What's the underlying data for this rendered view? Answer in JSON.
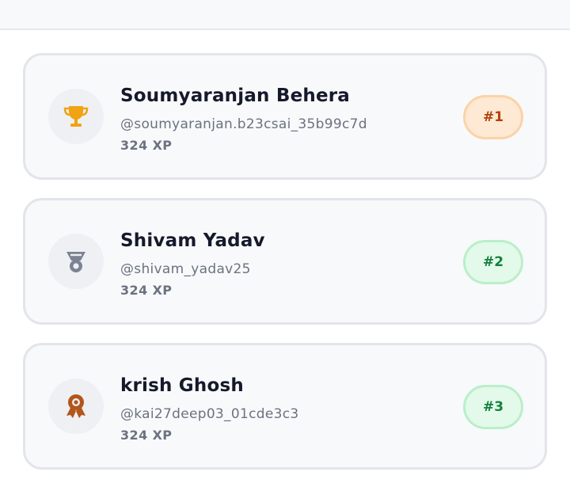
{
  "leaderboard": {
    "entries": [
      {
        "rank_label": "#1",
        "name": "Soumyaranjan Behera",
        "handle": "@soumyaranjan.b23csai_35b99c7d",
        "xp": "324 XP",
        "icon": "trophy-icon",
        "icon_color": "#f0a313",
        "badge_color": "#b4410f"
      },
      {
        "rank_label": "#2",
        "name": "Shivam Yadav",
        "handle": "@shivam_yadav25",
        "xp": "324 XP",
        "icon": "medal-icon",
        "icon_color": "#7b8291",
        "badge_color": "#15803d"
      },
      {
        "rank_label": "#3",
        "name": "krish Ghosh",
        "handle": "@kai27deep03_01cde3c3",
        "xp": "324 XP",
        "icon": "award-ribbon-icon",
        "icon_color": "#b3561b",
        "badge_color": "#15803d"
      }
    ]
  }
}
